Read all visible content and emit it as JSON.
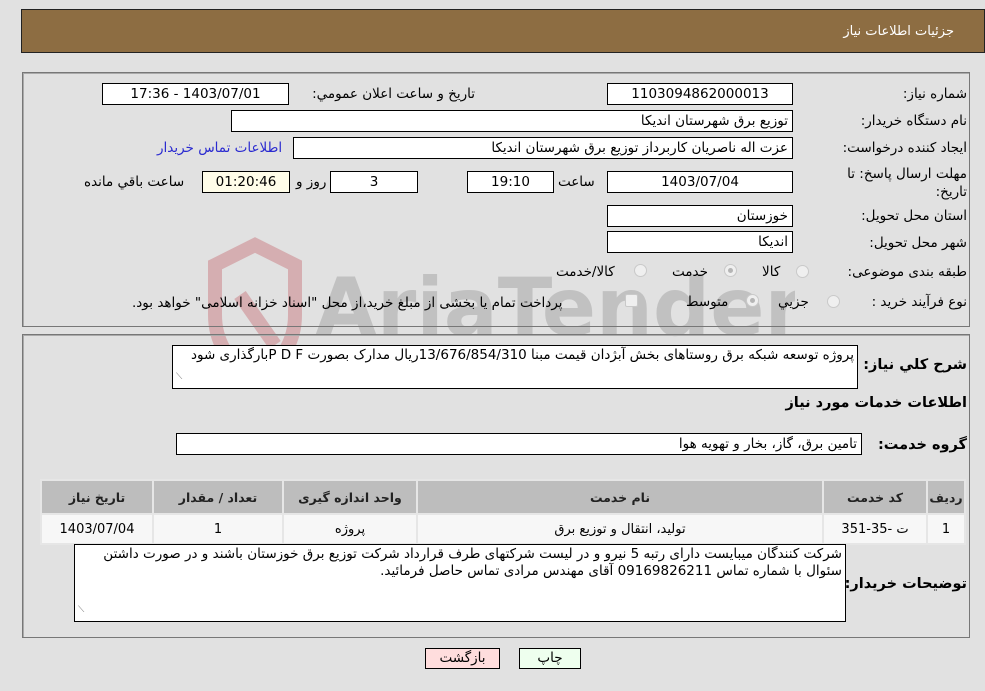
{
  "header": {
    "title": "جزئیات اطلاعات نیاز"
  },
  "fields": {
    "need_number_label": "شماره نیاز:",
    "need_number": "1103094862000013",
    "announce_label": "تاریخ و ساعت اعلان عمومي:",
    "announce_value": "1403/07/01 - 17:36",
    "buyer_org_label": "نام دستگاه خريدار:",
    "buyer_org": "توزیع برق شهرستان اندیکا",
    "creator_label": "ایجاد کننده درخواست:",
    "creator": "عزت اله ناصریان کاربرداز توزیع برق شهرستان اندیکا",
    "contact_link": "اطلاعات تماس خريدار",
    "deadline_label": "مهلت ارسال پاسخ: تا تاریخ:",
    "deadline_date": "1403/07/04",
    "time_label": "ساعت",
    "deadline_time": "19:10",
    "days": "3",
    "days_label": "روز و",
    "remaining": "01:20:46",
    "remaining_label": "ساعت باقي مانده",
    "province_label": "استان محل تحویل:",
    "province": "خوزستان",
    "city_label": "شهر محل تحویل:",
    "city": "اندیکا",
    "category_label": "طبقه بندی موضوعی:",
    "category_options": [
      "کالا",
      "خدمت",
      "کالا/خدمت"
    ],
    "category_selected": "خدمت",
    "process_label": "نوع فرآیند خرید :",
    "process_options": [
      "جزيي",
      "متوسط"
    ],
    "process_selected": "متوسط",
    "treasury_note": "پرداخت تمام یا بخشی از مبلغ خرید،از محل \"اسناد خزانه اسلامی\" خواهد بود."
  },
  "description": {
    "label": "شرح کلي نياز:",
    "text": "پروژه توسعه شبکه برق روستاهای بخش آبژدان قیمت مبنا 13/676/854/310ریال مدارک بصورت P D Fبارگذاری شود"
  },
  "services": {
    "section_title": "اطلاعات خدمات مورد نياز",
    "group_label": "گروه خدمت:",
    "group_value": "تامین برق، گاز، بخار و تهویه هوا",
    "columns": [
      "ردیف",
      "کد خدمت",
      "نام خدمت",
      "واحد اندازه گیری",
      "تعداد / مقدار",
      "تاریخ نیاز"
    ],
    "rows": [
      [
        "1",
        "ت -35-351",
        "تولید، انتقال و توزیع برق",
        "پروژه",
        "1",
        "1403/07/04"
      ]
    ]
  },
  "buyer_notes": {
    "label": "توضیحات خریدار:",
    "text": "شرکت کنندگان میبایست دارای رتبه 5 نیرو  و در لیست شرکتهای طرف قرارداد شرکت توزیع برق خوزستان باشند و در صورت داشتن سئوال با شماره تماس 09169826211 آقای مهندس مرادی تماس حاصل فرمائید."
  },
  "buttons": {
    "print": "چاپ",
    "back": "بازگشت"
  },
  "colors": {
    "header_bg": "#8d6d42",
    "print_bg": "#eeffee",
    "back_bg": "#ffdddd",
    "remaining_bg": "#fffde9"
  }
}
